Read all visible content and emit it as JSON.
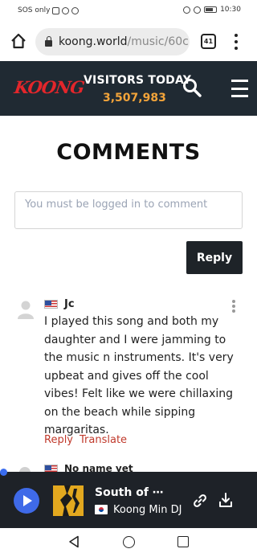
{
  "status_bar": {
    "carrier": "SOS only",
    "time": "10:30"
  },
  "browser": {
    "url_host": "koong.world",
    "url_path": "/music/60c",
    "tab_count": "41"
  },
  "site_header": {
    "logo_text": "KOONG",
    "visitors_label": "VISITORS TODAY",
    "visitors_count": "3,507,983"
  },
  "comments": {
    "title": "COMMENTS",
    "input_placeholder": "You must be logged in to comment",
    "reply_button": "Reply",
    "items": [
      {
        "author": "Jc",
        "country_flag": "us-flag",
        "text": "I played this song and both my daughter and I were jamming to the music n instruments. It's very upbeat and gives off the cool vibes! Felt like we were chillaxing on the beach while sipping margaritas.",
        "reply_label": "Reply",
        "translate_label": "Translate"
      },
      {
        "author": "No name yet",
        "country_flag": "us-flag"
      }
    ]
  },
  "player": {
    "track_title": "South of ⋯",
    "artist_flag": "kr-flag",
    "artist": "Koong Min DJ",
    "accent_color": "#3f6ae8"
  },
  "colors": {
    "header_bg": "#202a33",
    "logo_red": "#e3262b",
    "visitor_count_orange": "#f3a43a",
    "link_red": "#c0392b",
    "player_bg": "#1e2228"
  }
}
